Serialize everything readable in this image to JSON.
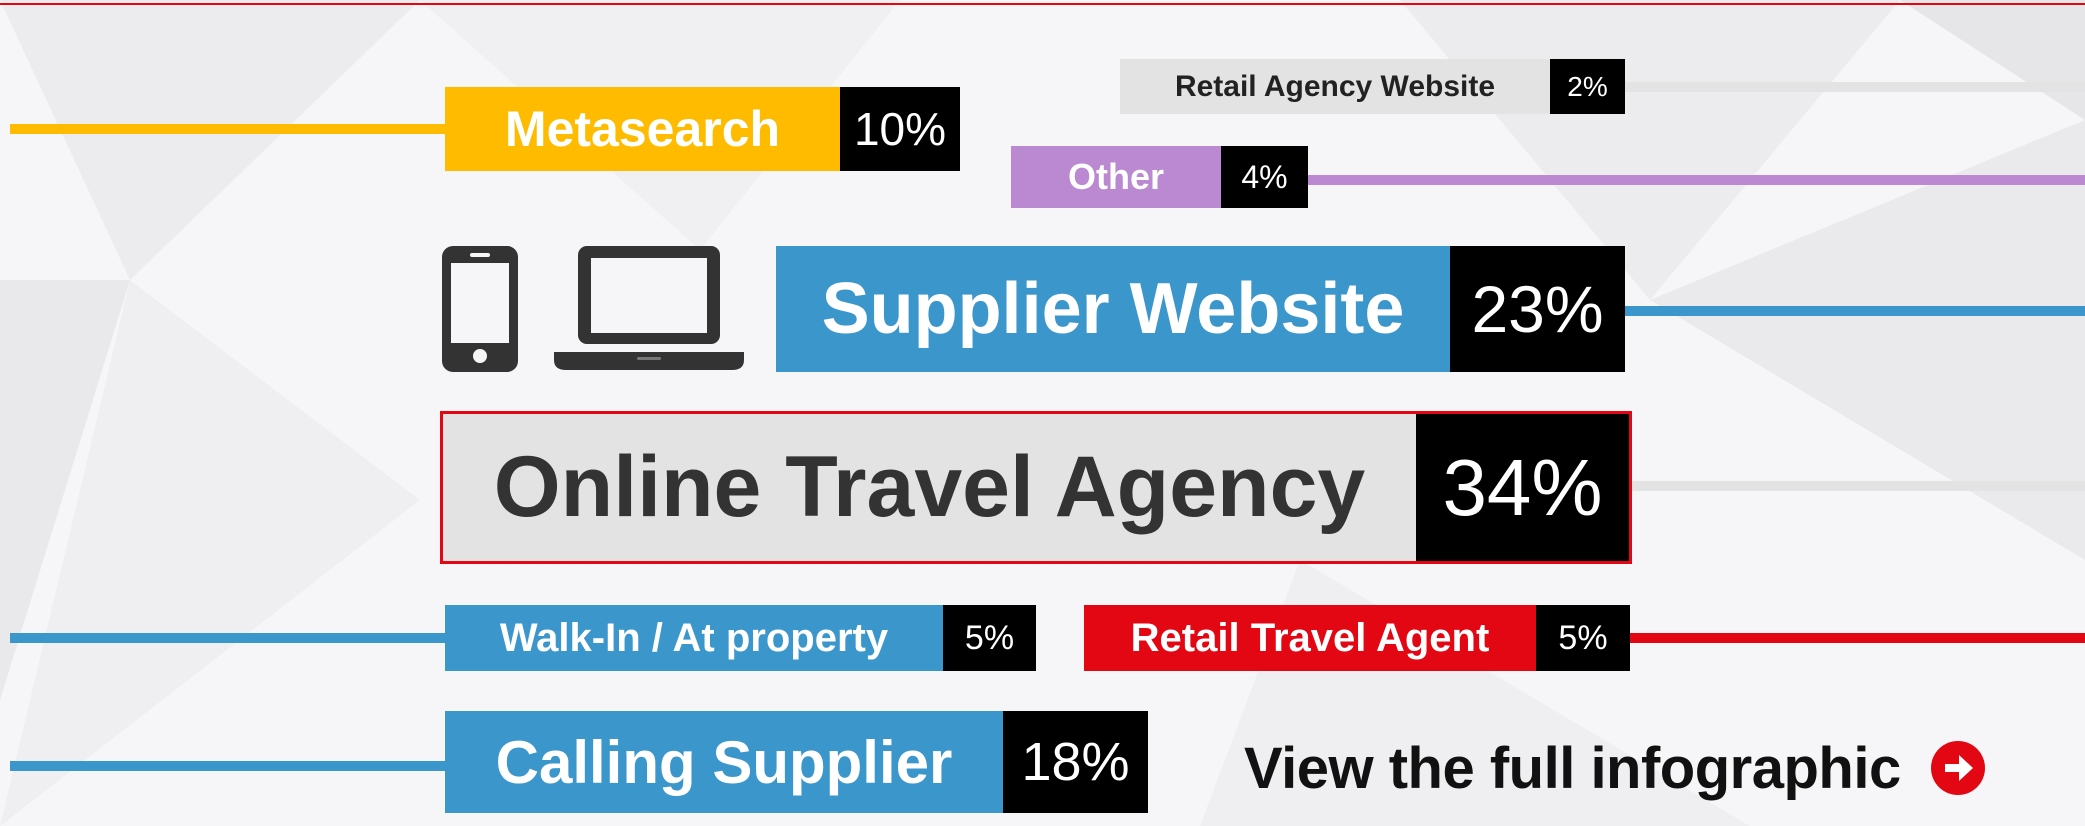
{
  "chart_data": {
    "type": "bar",
    "categories": [
      "Online Travel Agency",
      "Supplier Website",
      "Calling Supplier",
      "Metasearch",
      "Walk-In / At property",
      "Retail Travel Agent",
      "Other",
      "Retail Agency Website"
    ],
    "values": [
      34,
      23,
      18,
      10,
      5,
      5,
      4,
      2
    ],
    "value_labels": [
      "34%",
      "23%",
      "18%",
      "10%",
      "5%",
      "5%",
      "4%",
      "2%"
    ],
    "unit": "%",
    "highlighted": "Online Travel Agency",
    "colors": {
      "Online Travel Agency": "#e3e3e3",
      "Supplier Website": "#3b96cc",
      "Calling Supplier": "#3b96cc",
      "Metasearch": "#ffbb00",
      "Walk-In / At property": "#3b96cc",
      "Retail Travel Agent": "#e30613",
      "Other": "#bb88d2",
      "Retail Agency Website": "#e3e3e3"
    }
  },
  "icons": [
    "smartphone-icon",
    "laptop-icon",
    "arrow-circle-right-icon"
  ],
  "cta": {
    "label": "View the full infographic",
    "color": "#e30613"
  }
}
